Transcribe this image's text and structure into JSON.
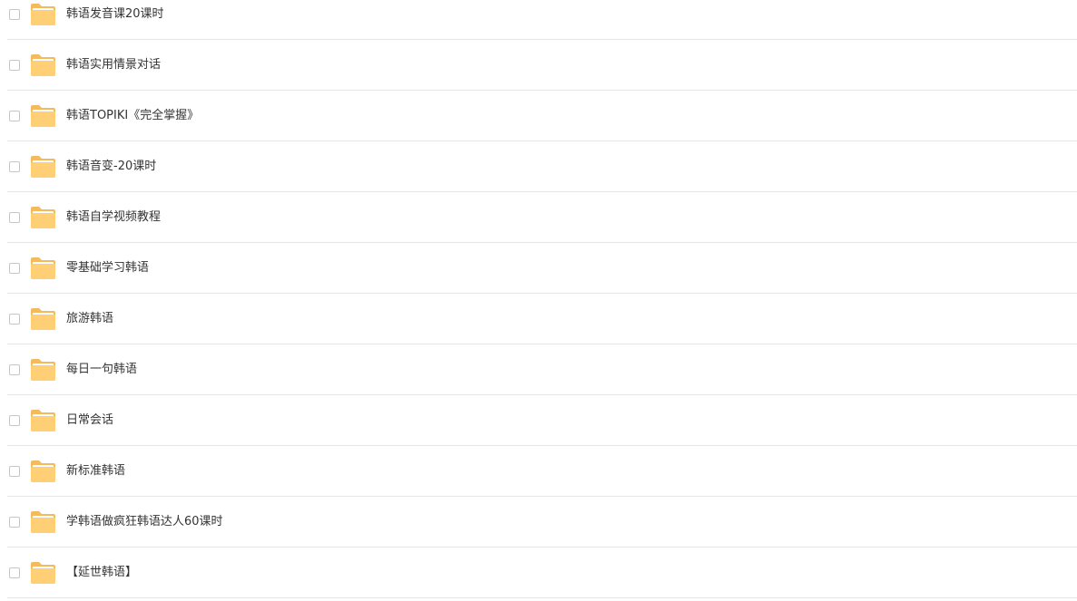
{
  "files": [
    {
      "name": "韩语发音课20课时",
      "type": "folder-icon"
    },
    {
      "name": "韩语实用情景对话",
      "type": "folder-icon"
    },
    {
      "name": "韩语TOPIKI《完全掌握》",
      "type": "folder-icon"
    },
    {
      "name": "韩语音变-20课时",
      "type": "folder-icon"
    },
    {
      "name": "韩语自学视频教程",
      "type": "folder-icon"
    },
    {
      "name": "零基础学习韩语",
      "type": "folder-icon"
    },
    {
      "name": "旅游韩语",
      "type": "folder-icon"
    },
    {
      "name": "每日一句韩语",
      "type": "folder-icon"
    },
    {
      "name": "日常会话",
      "type": "folder-icon"
    },
    {
      "name": "新标准韩语",
      "type": "folder-icon"
    },
    {
      "name": "学韩语做疯狂韩语达人60课时",
      "type": "folder-icon"
    },
    {
      "name": "【延世韩语】",
      "type": "folder-icon"
    }
  ],
  "colors": {
    "folder_back": "#f5b95f",
    "folder_front": "#ffcf76",
    "folder_paper": "#ffffff",
    "divider": "#e6e6e6",
    "text": "#333333"
  }
}
